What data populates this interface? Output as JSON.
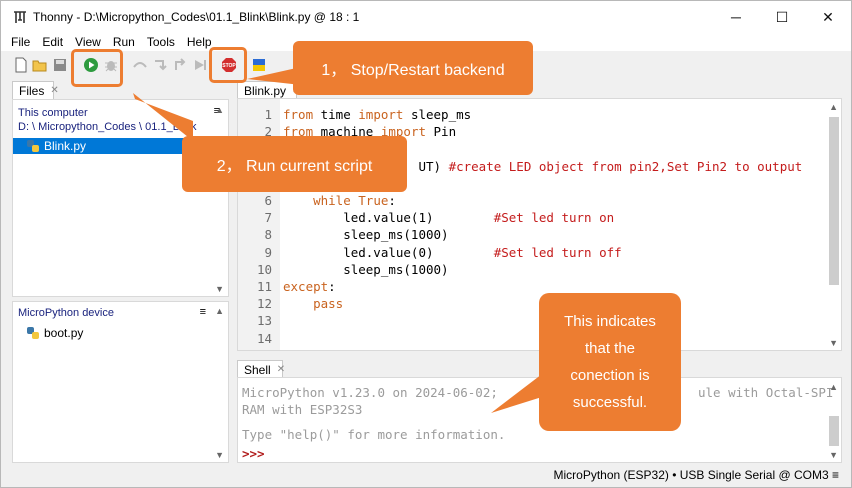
{
  "window": {
    "title": "Thonny  -  D:\\Micropython_Codes\\01.1_Blink\\Blink.py  @  18 : 1",
    "minimize": "─",
    "maximize": "☐",
    "close": "✕"
  },
  "menu": [
    "File",
    "Edit",
    "View",
    "Run",
    "Tools",
    "Help"
  ],
  "files_pane": {
    "tab_label": "Files",
    "this_computer_label": "This computer",
    "path": "D: \\ Micropython_Codes \\ 01.1_Blink",
    "files": [
      "Blink.py"
    ]
  },
  "device_pane": {
    "label": "MicroPython device",
    "files": [
      "boot.py"
    ]
  },
  "editor": {
    "tab_label": "Blink.py",
    "line_numbers": [
      "1",
      "2",
      "3",
      "4",
      "5",
      "6",
      "7",
      "8",
      "9",
      "10",
      "11",
      "12",
      "13",
      "14"
    ],
    "lines": [
      [
        {
          "t": "from",
          "c": "kw"
        },
        {
          "t": " time ",
          "c": ""
        },
        {
          "t": "import",
          "c": "kw"
        },
        {
          "t": " sleep_ms",
          "c": ""
        }
      ],
      [
        {
          "t": "from",
          "c": "kw"
        },
        {
          "t": " machine ",
          "c": ""
        },
        {
          "t": "import",
          "c": "kw"
        },
        {
          "t": " Pin",
          "c": ""
        }
      ],
      [],
      [
        {
          "t": "                  UT) ",
          "c": ""
        },
        {
          "t": "#create LED object from pin2,Set Pin2 to output",
          "c": "cm"
        }
      ],
      [],
      [
        {
          "t": "    ",
          "c": ""
        },
        {
          "t": "while",
          "c": "kw"
        },
        {
          "t": " ",
          "c": ""
        },
        {
          "t": "True",
          "c": "kw"
        },
        {
          "t": ":",
          "c": ""
        }
      ],
      [
        {
          "t": "        led.value(1)        ",
          "c": ""
        },
        {
          "t": "#Set led turn on",
          "c": "cm"
        }
      ],
      [
        {
          "t": "        sleep_ms(1000)",
          "c": ""
        }
      ],
      [
        {
          "t": "        led.value(0)        ",
          "c": ""
        },
        {
          "t": "#Set led turn off",
          "c": "cm"
        }
      ],
      [
        {
          "t": "        sleep_ms(1000)",
          "c": ""
        }
      ],
      [
        {
          "t": "except",
          "c": "kw"
        },
        {
          "t": ":",
          "c": ""
        }
      ],
      [
        {
          "t": "    ",
          "c": ""
        },
        {
          "t": "pass",
          "c": "kw"
        }
      ],
      [],
      []
    ]
  },
  "shell": {
    "tab_label": "Shell",
    "line1": "MicroPython v1.23.0 on 2024-06-02;",
    "line1_end": "ule with Octal-SPI",
    "line2": "RAM with ESP32S3",
    "line3": "Type \"help()\" for more information.",
    "prompt": ">>>"
  },
  "status": {
    "text": "MicroPython (ESP32)  •  USB Single Serial @ COM3  ≡"
  },
  "callouts": {
    "stop": "1，  Stop/Restart backend",
    "run": "2，  Run current script",
    "connection": "This indicates that the conection is successful."
  },
  "colors": {
    "callout": "#ed7d31",
    "keyword": "#c9631f",
    "comment": "#c41c1c",
    "selection": "#0078d7"
  }
}
